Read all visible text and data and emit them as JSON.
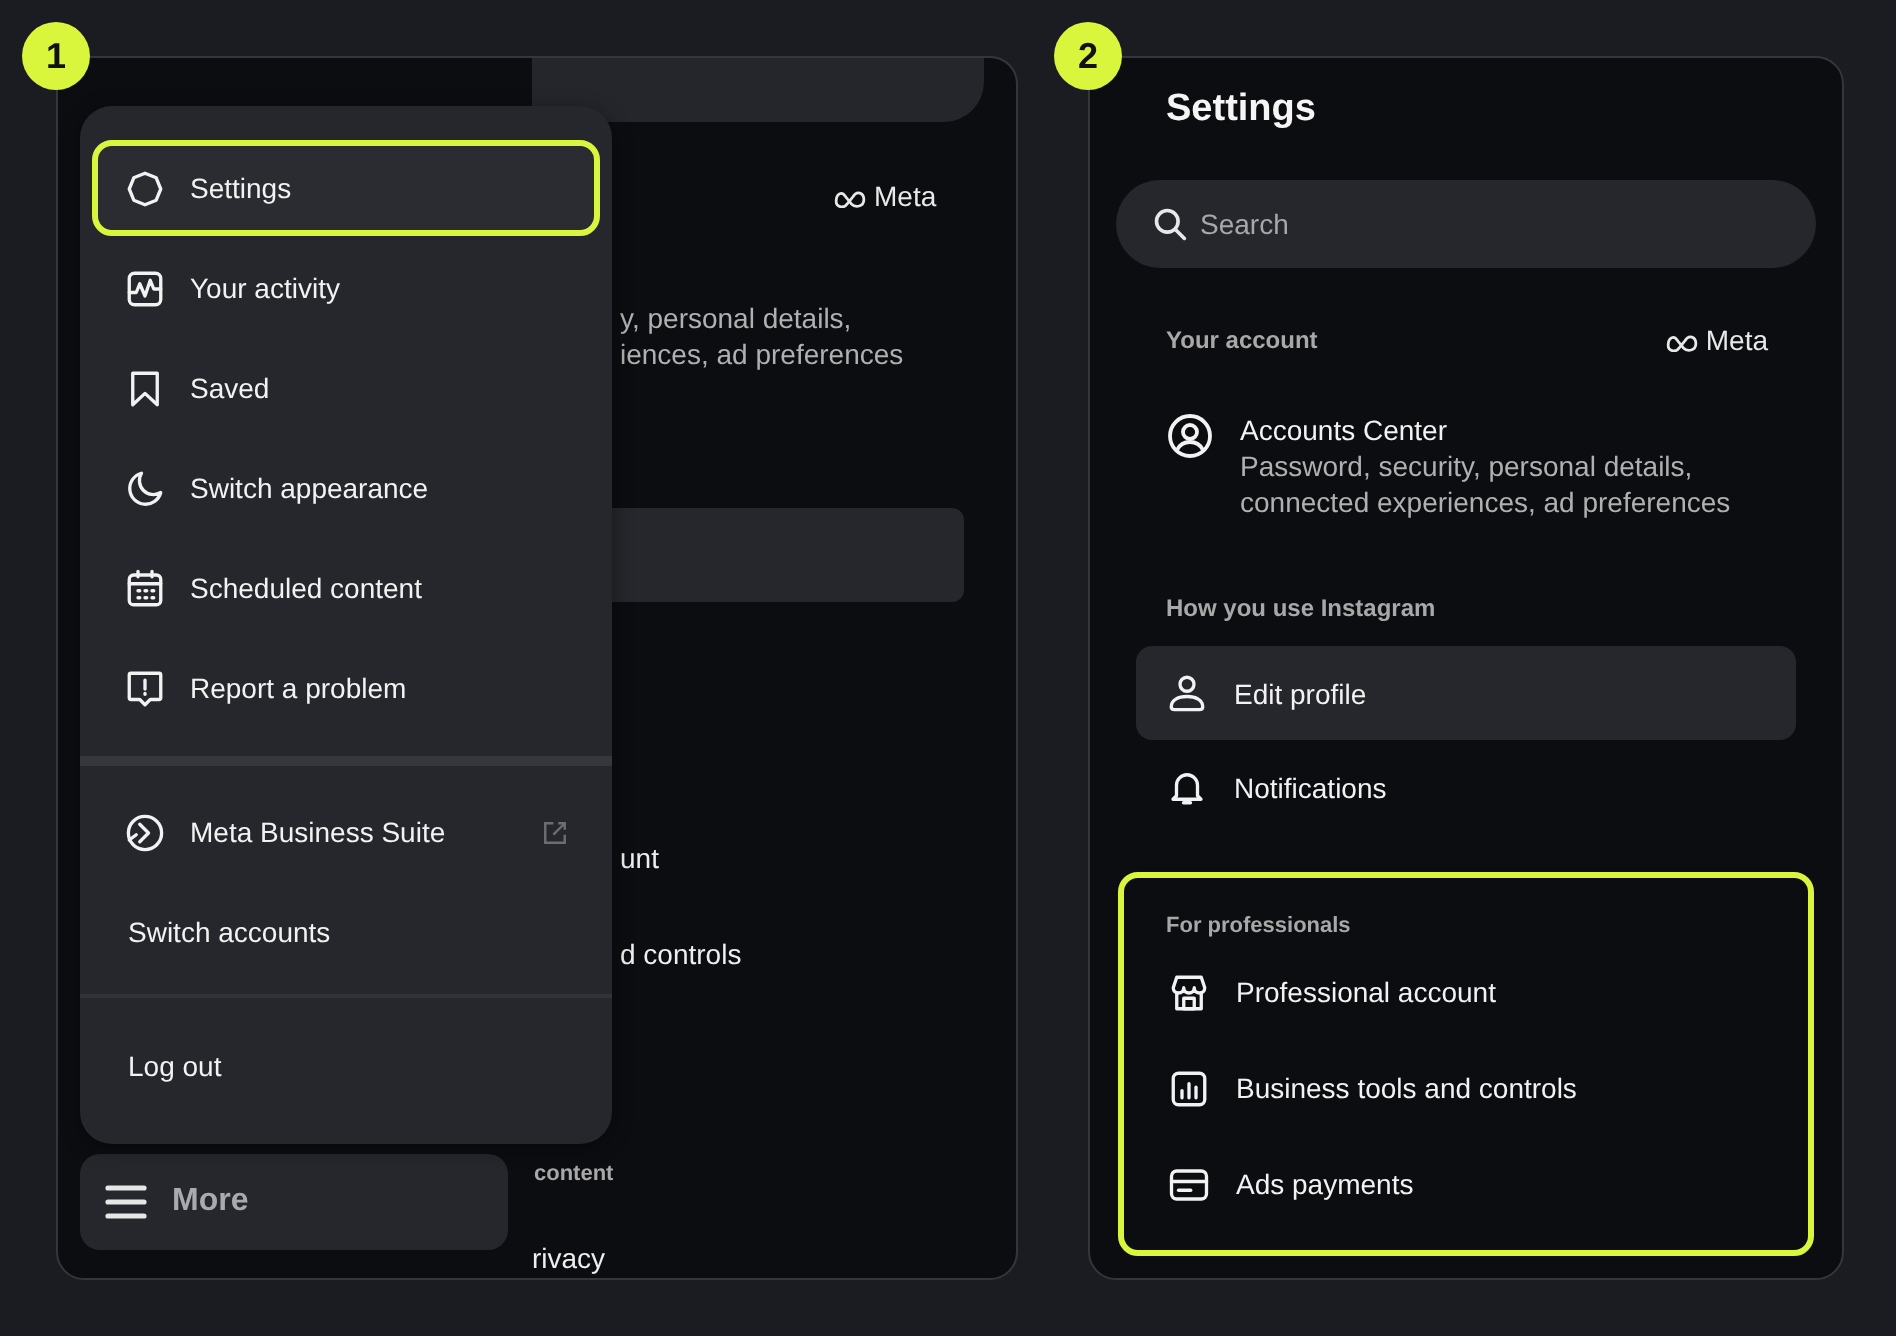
{
  "left_panel": {
    "step": "1",
    "background": {
      "brand": "Meta",
      "description": [
        "y, personal details,",
        "iences, ad preferences"
      ],
      "rows": [
        "unt",
        "d controls"
      ],
      "section_heading": "content",
      "last_row": "rivacy"
    },
    "menu": {
      "sections": [
        {
          "items": [
            {
              "label": "Settings",
              "kind": "icon",
              "highlighted": true,
              "external": false
            },
            {
              "label": "Your activity",
              "kind": "icon",
              "highlighted": false,
              "external": false
            },
            {
              "label": "Saved",
              "kind": "icon",
              "highlighted": false,
              "external": false
            },
            {
              "label": "Switch appearance",
              "kind": "icon",
              "highlighted": false,
              "external": false
            },
            {
              "label": "Scheduled content",
              "kind": "icon",
              "highlighted": false,
              "external": false
            },
            {
              "label": "Report a problem",
              "kind": "icon",
              "highlighted": false,
              "external": false
            }
          ]
        },
        {
          "items": [
            {
              "label": "Meta Business Suite",
              "kind": "icon",
              "highlighted": false,
              "external": true
            },
            {
              "label": "Switch accounts",
              "kind": "plain",
              "highlighted": false,
              "external": false
            }
          ]
        },
        {
          "items": [
            {
              "label": "Log out",
              "kind": "plain",
              "highlighted": false,
              "external": false
            }
          ]
        }
      ]
    },
    "more_button": {
      "label": "More"
    }
  },
  "right_panel": {
    "step": "2",
    "title": "Settings",
    "search": {
      "placeholder": "Search"
    },
    "sections": [
      {
        "heading": "Your account",
        "brand": "Meta",
        "highlighted": false,
        "items": [
          {
            "label": "Accounts Center",
            "description": "Password, security, personal details, connected experiences, ad preferences",
            "selected": false
          }
        ]
      },
      {
        "heading": "How you use Instagram",
        "highlighted": false,
        "items": [
          {
            "label": "Edit profile",
            "selected": true
          },
          {
            "label": "Notifications",
            "selected": false
          }
        ]
      },
      {
        "heading": "For professionals",
        "highlighted": true,
        "items": [
          {
            "label": "Professional account",
            "selected": false
          },
          {
            "label": "Business tools and controls",
            "selected": false
          },
          {
            "label": "Ads payments",
            "selected": false
          }
        ]
      }
    ]
  }
}
